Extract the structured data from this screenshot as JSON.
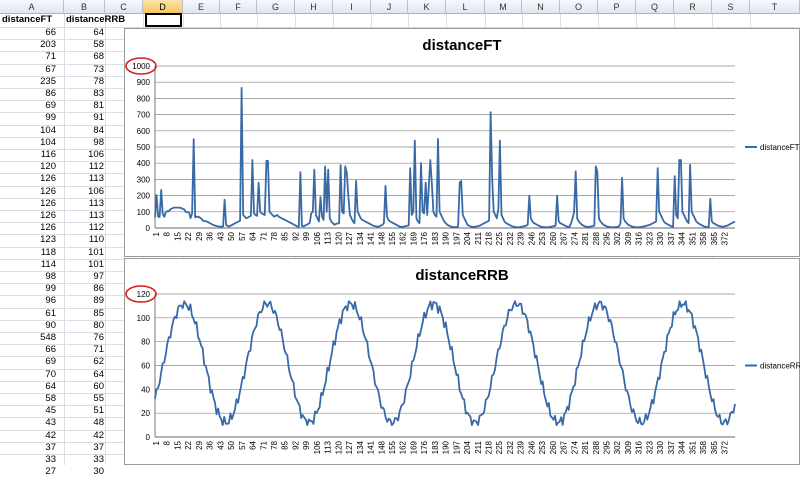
{
  "spreadsheet": {
    "columns": [
      "A",
      "B",
      "C",
      "D",
      "E",
      "F",
      "G",
      "H",
      "I",
      "J",
      "K",
      "L",
      "M",
      "N",
      "O",
      "P",
      "Q",
      "R",
      "S",
      "T"
    ],
    "selected_column": "D",
    "headers": [
      "distanceFT",
      "distanceRRB"
    ],
    "rows": [
      [
        66,
        64
      ],
      [
        203,
        58
      ],
      [
        71,
        68
      ],
      [
        67,
        73
      ],
      [
        235,
        78
      ],
      [
        86,
        83
      ],
      [
        69,
        81
      ],
      [
        99,
        91
      ],
      [
        104,
        84
      ],
      [
        104,
        98
      ],
      [
        116,
        106
      ],
      [
        120,
        112
      ],
      [
        126,
        113
      ],
      [
        126,
        106
      ],
      [
        126,
        113
      ],
      [
        126,
        113
      ],
      [
        126,
        112
      ],
      [
        123,
        110
      ],
      [
        118,
        101
      ],
      [
        114,
        101
      ],
      [
        98,
        97
      ],
      [
        99,
        86
      ],
      [
        96,
        89
      ],
      [
        61,
        85
      ],
      [
        90,
        80
      ],
      [
        548,
        76
      ],
      [
        66,
        71
      ],
      [
        69,
        62
      ],
      [
        70,
        64
      ],
      [
        64,
        60
      ],
      [
        58,
        55
      ],
      [
        45,
        51
      ],
      [
        43,
        48
      ],
      [
        42,
        42
      ],
      [
        37,
        37
      ],
      [
        33,
        33
      ],
      [
        27,
        30
      ]
    ]
  },
  "charts": [
    {
      "title": "distanceFT",
      "legend": "distanceFT",
      "y_ticks": [
        "0",
        "100",
        "200",
        "300",
        "400",
        "500",
        "600",
        "700",
        "800",
        "900",
        "1000"
      ],
      "highlight_label": "1000",
      "x_ticks": [
        "1",
        "8",
        "15",
        "22",
        "29",
        "36",
        "43",
        "50",
        "57",
        "64",
        "71",
        "78",
        "85",
        "92",
        "99",
        "106",
        "113",
        "120",
        "127",
        "134",
        "141",
        "148",
        "155",
        "162",
        "169",
        "176",
        "183",
        "190",
        "197",
        "204",
        "211",
        "218",
        "225",
        "232",
        "239",
        "246",
        "253",
        "260",
        "267",
        "274",
        "281",
        "288",
        "295",
        "302",
        "309",
        "316",
        "323",
        "330",
        "337",
        "344",
        "351",
        "358",
        "365",
        "372"
      ]
    },
    {
      "title": "distanceRRB",
      "legend": "distanceRRB",
      "y_ticks": [
        "0",
        "20",
        "40",
        "60",
        "80",
        "100",
        "120"
      ],
      "highlight_label": "120",
      "x_ticks": [
        "1",
        "8",
        "15",
        "22",
        "29",
        "36",
        "43",
        "50",
        "57",
        "64",
        "71",
        "78",
        "85",
        "92",
        "99",
        "106",
        "113",
        "120",
        "127",
        "134",
        "141",
        "148",
        "155",
        "162",
        "169",
        "176",
        "183",
        "190",
        "197",
        "204",
        "211",
        "218",
        "225",
        "232",
        "239",
        "246",
        "253",
        "260",
        "267",
        "274",
        "281",
        "288",
        "295",
        "302",
        "309",
        "316",
        "323",
        "330",
        "337",
        "344",
        "351",
        "358",
        "365",
        "372"
      ]
    }
  ],
  "chart_data": [
    {
      "type": "line",
      "title": "distanceFT",
      "ylim": [
        0,
        1000
      ],
      "x_range": [
        1,
        378
      ],
      "series": [
        {
          "name": "distanceFT",
          "values": [
            66,
            203,
            71,
            67,
            235,
            86,
            69,
            99,
            104,
            104,
            116,
            120,
            126,
            126,
            126,
            126,
            126,
            123,
            118,
            114,
            98,
            99,
            96,
            61,
            90,
            548,
            66,
            69,
            70,
            64,
            58,
            45,
            43,
            42,
            37,
            33,
            27,
            22,
            18,
            15,
            12,
            10,
            9,
            8,
            10,
            175,
            20,
            12,
            10,
            15,
            20,
            25,
            30,
            35,
            40,
            45,
            865,
            80,
            70,
            60,
            65,
            70,
            75,
            420,
            90,
            80,
            75,
            280,
            100,
            90,
            85,
            80,
            415,
            415,
            100,
            90,
            80,
            70,
            75,
            80,
            70,
            65,
            60,
            55,
            50,
            45,
            40,
            35,
            30,
            25,
            20,
            15,
            10,
            8,
            345,
            12,
            10,
            15,
            20,
            25,
            30,
            90,
            100,
            360,
            80,
            60,
            40,
            190,
            70,
            50,
            380,
            100,
            360,
            60,
            40,
            30,
            20,
            25,
            28,
            30,
            388,
            100,
            90,
            380,
            340,
            200,
            80,
            60,
            40,
            30,
            290,
            100,
            80,
            60,
            50,
            45,
            40,
            35,
            30,
            25,
            20,
            15,
            12,
            10,
            8,
            10,
            15,
            20,
            30,
            260,
            70,
            50,
            40,
            35,
            30,
            25,
            20,
            15,
            10,
            8,
            6,
            10,
            12,
            14,
            16,
            370,
            80,
            100,
            540,
            60,
            40,
            30,
            400,
            100,
            90,
            280,
            80,
            260,
            420,
            270,
            100,
            80,
            70,
            550,
            100,
            80,
            60,
            40,
            30,
            20,
            15,
            10,
            8,
            6,
            5,
            6,
            10,
            280,
            290,
            80,
            60,
            40,
            20,
            15,
            10,
            8,
            6,
            8,
            10,
            12,
            15,
            20,
            25,
            30,
            35,
            40,
            45,
            715,
            300,
            100,
            80,
            60,
            120,
            540,
            80,
            60,
            40,
            30,
            25,
            20,
            15,
            10,
            8,
            6,
            5,
            4,
            6,
            8,
            10,
            12,
            15,
            20,
            200,
            60,
            40,
            30,
            25,
            20,
            15,
            10,
            8,
            6,
            5,
            4,
            5,
            6,
            8,
            10,
            12,
            15,
            200,
            40,
            30,
            25,
            20,
            15,
            10,
            8,
            6,
            30,
            60,
            100,
            350,
            60,
            40,
            30,
            20,
            15,
            10,
            8,
            6,
            8,
            10,
            12,
            15,
            380,
            350,
            60,
            40,
            30,
            20,
            15,
            10,
            8,
            6,
            5,
            4,
            5,
            6,
            8,
            10,
            30,
            310,
            60,
            40,
            30,
            20,
            15,
            10,
            8,
            6,
            5,
            4,
            5,
            6,
            8,
            10,
            12,
            15,
            18,
            20,
            25,
            30,
            35,
            40,
            370,
            100,
            80,
            60,
            40,
            30,
            25,
            20,
            15,
            10,
            8,
            320,
            80,
            60,
            420,
            420,
            100,
            80,
            60,
            40,
            30,
            390,
            100,
            80,
            60,
            40,
            30,
            25,
            20,
            15,
            10,
            8,
            6,
            5,
            180,
            40,
            30,
            25,
            20,
            15,
            12,
            10,
            8,
            10,
            12,
            15,
            20,
            25,
            30,
            35,
            40
          ]
        }
      ]
    },
    {
      "type": "line",
      "title": "distanceRRB",
      "ylim": [
        0,
        120
      ],
      "x_range": [
        1,
        378
      ],
      "series": [
        {
          "name": "distanceRRB",
          "values": "periodic"
        }
      ]
    }
  ]
}
